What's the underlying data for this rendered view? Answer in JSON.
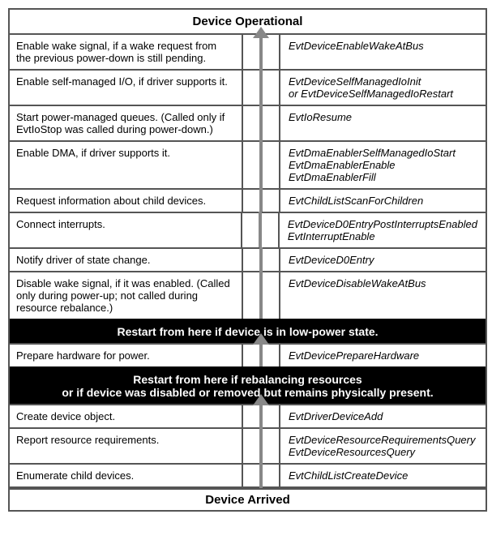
{
  "headers": {
    "top": "Device Operational",
    "bottom": "Device Arrived"
  },
  "sections": {
    "group1": [
      {
        "desc": "Enable wake signal, if a wake request from the previous power-down is still pending.",
        "callbacks": [
          "EvtDeviceEnableWakeAtBus"
        ]
      },
      {
        "desc": "Enable self-managed I/O, if driver supports it.",
        "callbacks": [
          "EvtDeviceSelfManagedIoInit",
          "or EvtDeviceSelfManagedIoRestart"
        ]
      },
      {
        "desc": "Start power-managed queues. (Called only if EvtIoStop was called during power-down.)",
        "callbacks": [
          "EvtIoResume"
        ]
      },
      {
        "desc": "Enable DMA, if driver supports it.",
        "callbacks": [
          "EvtDmaEnablerSelfManagedIoStart",
          "EvtDmaEnablerEnable",
          "EvtDmaEnablerFill"
        ]
      },
      {
        "desc": "Request information about child devices.",
        "callbacks": [
          "EvtChildListScanForChildren"
        ]
      },
      {
        "desc": "Connect interrupts.",
        "callbacks": [
          "EvtDeviceD0EntryPostInterruptsEnabled",
          "EvtInterruptEnable"
        ]
      },
      {
        "desc": "Notify driver of state change.",
        "callbacks": [
          "EvtDeviceD0Entry"
        ]
      },
      {
        "desc": "Disable wake signal, if it was enabled. (Called only during power-up; not called during resource rebalance.)",
        "callbacks": [
          "EvtDeviceDisableWakeAtBus"
        ]
      }
    ],
    "bar1": "Restart from here if device is in low-power state.",
    "group2": [
      {
        "desc": "Prepare hardware for power.",
        "callbacks": [
          "EvtDevicePrepareHardware"
        ]
      }
    ],
    "bar2_lines": [
      "Restart from here if rebalancing resources",
      "or if device was disabled or removed but remains physically present."
    ],
    "group3": [
      {
        "desc": "Create device object.",
        "callbacks": [
          "EvtDriverDeviceAdd"
        ]
      },
      {
        "desc": "Report resource requirements.",
        "callbacks": [
          "EvtDeviceResourceRequirementsQuery",
          "EvtDeviceResourcesQuery"
        ]
      },
      {
        "desc": "Enumerate child devices.",
        "callbacks": [
          "EvtChildListCreateDevice"
        ]
      }
    ]
  }
}
